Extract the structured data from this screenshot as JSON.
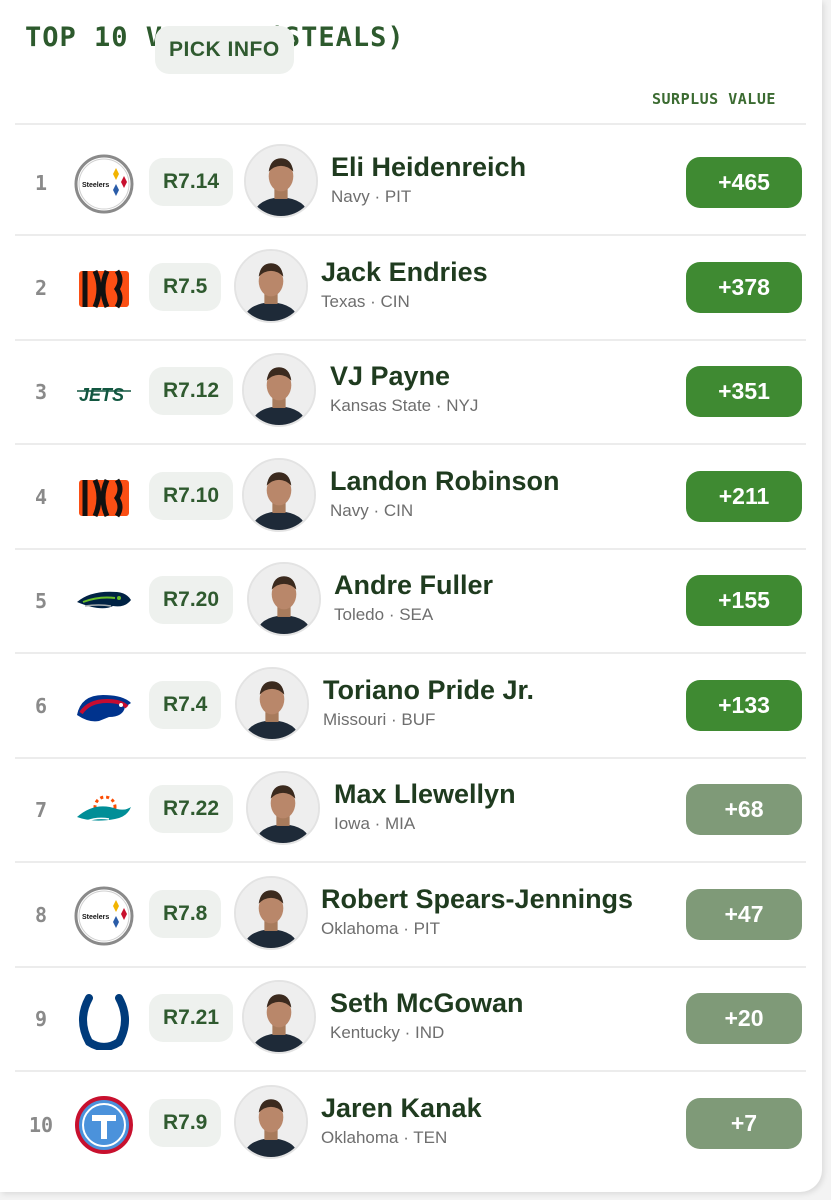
{
  "title": "TOP 10 VALUES (STEALS)",
  "headers": {
    "pick_info": "PICK INFO",
    "surplus_value": "SURPLUS VALUE"
  },
  "colors": {
    "high_value": "#3f8a32",
    "low_value": "#7f9a78",
    "title": "#2d5a2d"
  },
  "rows": [
    {
      "rank": "1",
      "team": "pittsburgh-steelers-logo",
      "logo_text": "Steelers",
      "pick": "R7.14",
      "name": "Eli Heidenreich",
      "school": "Navy · PIT",
      "value": "+465",
      "tier": "high"
    },
    {
      "rank": "2",
      "team": "cincinnati-bengals-logo",
      "pick": "R7.5",
      "name": "Jack Endries",
      "school": "Texas · CIN",
      "value": "+378",
      "tier": "high"
    },
    {
      "rank": "3",
      "team": "new-york-jets-logo",
      "logo_text": "JETS",
      "pick": "R7.12",
      "name": "VJ Payne",
      "school": "Kansas State · NYJ",
      "value": "+351",
      "tier": "high"
    },
    {
      "rank": "4",
      "team": "cincinnati-bengals-logo",
      "pick": "R7.10",
      "name": "Landon Robinson",
      "school": "Navy · CIN",
      "value": "+211",
      "tier": "high"
    },
    {
      "rank": "5",
      "team": "seattle-seahawks-logo",
      "pick": "R7.20",
      "name": "Andre Fuller",
      "school": "Toledo · SEA",
      "value": "+155",
      "tier": "high"
    },
    {
      "rank": "6",
      "team": "buffalo-bills-logo",
      "pick": "R7.4",
      "name": "Toriano Pride Jr.",
      "school": "Missouri · BUF",
      "value": "+133",
      "tier": "high"
    },
    {
      "rank": "7",
      "team": "miami-dolphins-logo",
      "pick": "R7.22",
      "name": "Max Llewellyn",
      "school": "Iowa · MIA",
      "value": "+68",
      "tier": "low"
    },
    {
      "rank": "8",
      "team": "pittsburgh-steelers-logo",
      "logo_text": "Steelers",
      "pick": "R7.8",
      "name": "Robert Spears-Jennings",
      "school": "Oklahoma · PIT",
      "value": "+47",
      "tier": "low"
    },
    {
      "rank": "9",
      "team": "indianapolis-colts-logo",
      "pick": "R7.21",
      "name": "Seth McGowan",
      "school": "Kentucky · IND",
      "value": "+20",
      "tier": "low"
    },
    {
      "rank": "10",
      "team": "tennessee-titans-logo",
      "pick": "R7.9",
      "name": "Jaren Kanak",
      "school": "Oklahoma · TEN",
      "value": "+7",
      "tier": "low"
    }
  ]
}
